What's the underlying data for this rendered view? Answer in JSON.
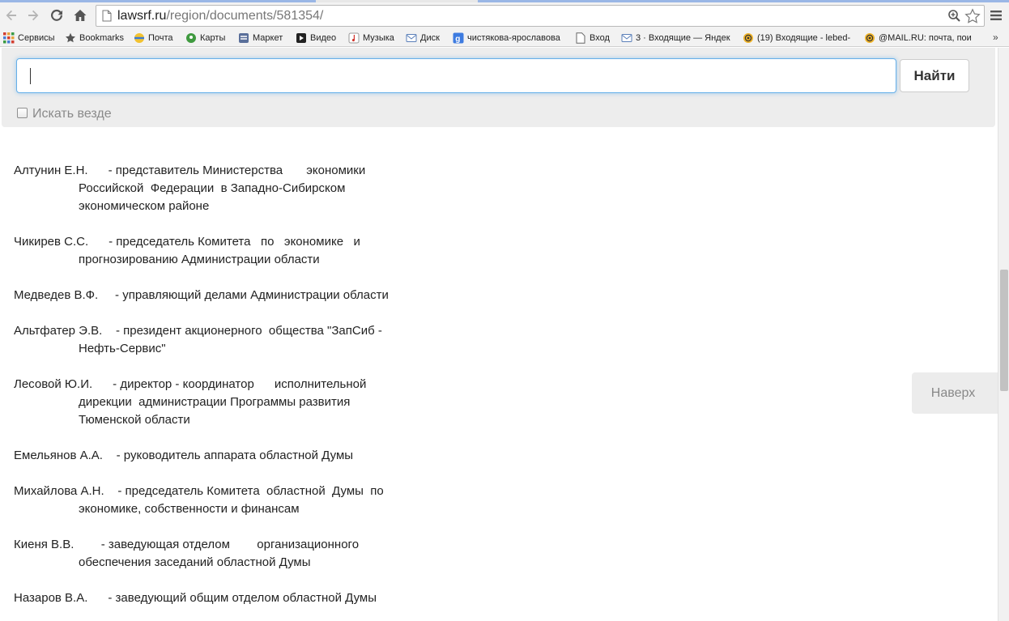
{
  "browser": {
    "url_host": "lawsrf.ru",
    "url_path": "/region/documents/581354/",
    "bookmarks": [
      {
        "label": "Сервисы",
        "icon": "apps-grid-icon"
      },
      {
        "label": "Bookmarks",
        "icon": "star-icon"
      },
      {
        "label": "Почта",
        "icon": "mail-globe-icon"
      },
      {
        "label": "Карты",
        "icon": "maps-icon"
      },
      {
        "label": "Маркет",
        "icon": "market-icon"
      },
      {
        "label": "Видео",
        "icon": "video-icon"
      },
      {
        "label": "Музыка",
        "icon": "music-icon"
      },
      {
        "label": "Диск",
        "icon": "disk-mail-icon"
      },
      {
        "label": "чистякова-ярославова",
        "icon": "google-plus-icon"
      },
      {
        "label": "Вход",
        "icon": "page-icon"
      },
      {
        "label": "3 · Входящие — Яндек",
        "icon": "mail-icon"
      },
      {
        "label": "(19) Входящие - lebed-",
        "icon": "at-sign-icon"
      },
      {
        "label": "@MAIL.RU: почта, пои",
        "icon": "at-sign-icon"
      }
    ],
    "more_label": "»"
  },
  "search": {
    "value": "",
    "button_label": "Найти",
    "everywhere_label": "Искать везде",
    "everywhere_checked": false
  },
  "document": {
    "entries": [
      {
        "lines": [
          "Алтунин Е.Н.      - представитель Министерства       экономики",
          "Российской  Федерации  в Западно-Сибирском",
          "экономическом районе"
        ]
      },
      {
        "lines": [
          "Чикирев С.С.      - председатель Комитета   по   экономике   и",
          "прогнозированию Администрации области"
        ]
      },
      {
        "lines": [
          "Медведев В.Ф.     - управляющий делами Администрации области"
        ]
      },
      {
        "lines": [
          "Альтфатер Э.В.    - президент акционерного  общества \"ЗапСиб -",
          "Нефть-Сервис\""
        ]
      },
      {
        "lines": [
          "Лесовой Ю.И.      - директор - координатор      исполнительной",
          "дирекции  администрации Программы развития",
          "Тюменской области"
        ]
      },
      {
        "lines": [
          "Емельянов А.А.    - руководитель аппарата областной Думы"
        ]
      },
      {
        "lines": [
          "Михайлова А.Н.    - председатель Комитета  областной  Думы  по",
          "экономике, собственности и финансам"
        ]
      },
      {
        "lines": [
          "Киеня В.В.        - заведующая отделом        организационного",
          "обеспечения заседаний областной Думы"
        ]
      },
      {
        "lines": [
          "Назаров В.А.      - заведующий общим отделом областной Думы"
        ]
      }
    ]
  },
  "to_top_label": "Наверх",
  "colors": {
    "focus_border": "#66afe9",
    "panel_bg": "#ededed"
  }
}
